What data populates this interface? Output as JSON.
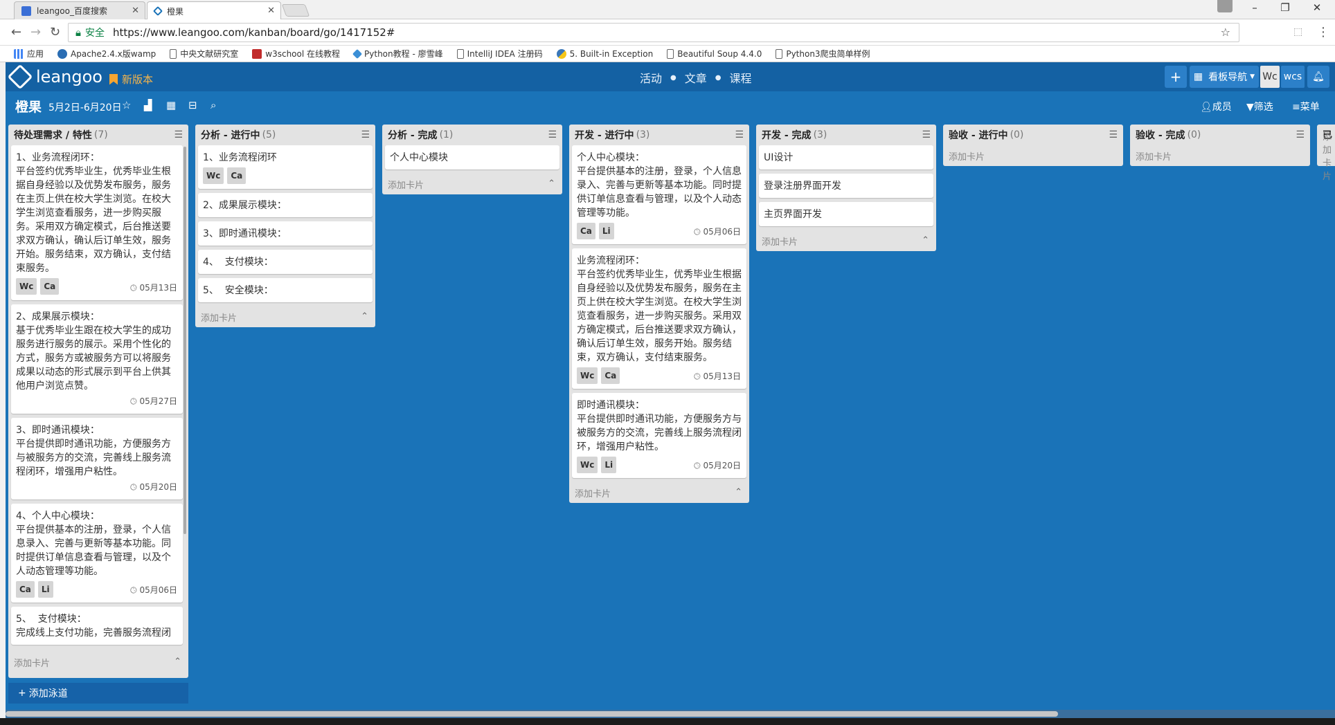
{
  "browser": {
    "tabs": [
      {
        "title": "leangoo_百度搜索",
        "active": false
      },
      {
        "title": "橙果",
        "active": true
      }
    ],
    "security_label": "安全",
    "url": "https://www.leangoo.com/kanban/board/go/1417152#",
    "bookmarks": [
      "应用",
      "Apache2.4.x版wamp",
      "中央文献研究室",
      "w3school 在线教程",
      "Python教程 - 廖雪峰",
      "IntelliJ IDEA 注册码",
      "5. Built-in Exception",
      "Beautiful Soup 4.4.0",
      "Python3爬虫简单样例"
    ]
  },
  "app": {
    "logo": "leangoo",
    "new_version": "新版本",
    "center_nav": [
      "活动",
      "文章",
      "课程"
    ],
    "board_nav_label": "看板导航",
    "avatars": [
      "Wc",
      "wcs"
    ],
    "board_title": "橙果",
    "board_dates": "5月2日-6月20日",
    "right_actions": [
      "成员",
      "筛选",
      "菜单"
    ],
    "add_card": "添加卡片",
    "add_lane": "添加泳道"
  },
  "lists": [
    {
      "name": "待处理需求 / 特性",
      "count": "(7)",
      "cards": [
        {
          "title": "1、业务流程闭环：\n平台签约优秀毕业生，优秀毕业生根据自身经验以及优势发布服务，服务在主页上供在校大学生浏览。在校大学生浏览查看服务，进一步购买服务。采用双方确定模式，后台推送要求双方确认，确认后订单生效，服务开始。服务结束，双方确认，支付结束服务。",
          "tags": [
            "Wc",
            "Ca"
          ],
          "date": "05月13日"
        },
        {
          "title": "2、成果展示模块：\n基于优秀毕业生跟在校大学生的成功服务进行服务的展示。采用个性化的方式，服务方或被服务方可以将服务成果以动态的形式展示到平台上供其他用户浏览点赞。",
          "tags": [],
          "date": "05月27日"
        },
        {
          "title": "3、即时通讯模块：\n平台提供即时通讯功能，方便服务方与被服务方的交流，完善线上服务流程闭环，增强用户粘性。",
          "tags": [],
          "date": "05月20日"
        },
        {
          "title": "4、个人中心模块：\n平台提供基本的注册，登录，个人信息录入、完善与更新等基本功能。同时提供订单信息查看与管理，以及个人动态管理等功能。",
          "tags": [
            "Ca",
            "Li"
          ],
          "date": "05月06日"
        },
        {
          "title": "5、  支付模块：\n完成线上支付功能，完善服务流程闭",
          "tags": [],
          "date": ""
        }
      ]
    },
    {
      "name": "分析  - 进行中",
      "count": "(5)",
      "cards": [
        {
          "title": "1、业务流程闭环",
          "tags": [
            "Wc",
            "Ca"
          ],
          "date": ""
        },
        {
          "title": "2、成果展示模块：",
          "tags": [],
          "date": ""
        },
        {
          "title": "3、即时通讯模块：",
          "tags": [],
          "date": ""
        },
        {
          "title": "4、  支付模块：",
          "tags": [],
          "date": ""
        },
        {
          "title": "5、  安全模块：",
          "tags": [],
          "date": ""
        }
      ]
    },
    {
      "name": "分析 - 完成",
      "count": "(1)",
      "cards": [
        {
          "title": "个人中心模块",
          "tags": [],
          "date": ""
        }
      ]
    },
    {
      "name": "开发 - 进行中",
      "count": "(3)",
      "cards": [
        {
          "title": "个人中心模块：\n平台提供基本的注册，登录，个人信息录入、完善与更新等基本功能。同时提供订单信息查看与管理，以及个人动态管理等功能。",
          "tags": [
            "Ca",
            "Li"
          ],
          "date": "05月06日"
        },
        {
          "title": "业务流程闭环：\n平台签约优秀毕业生，优秀毕业生根据自身经验以及优势发布服务，服务在主页上供在校大学生浏览。在校大学生浏览查看服务，进一步购买服务。采用双方确定模式，后台推送要求双方确认，确认后订单生效，服务开始。服务结束，双方确认，支付结束服务。",
          "tags": [
            "Wc",
            "Ca"
          ],
          "date": "05月13日"
        },
        {
          "title": "即时通讯模块：\n平台提供即时通讯功能，方便服务方与被服务方的交流，完善线上服务流程闭环，增强用户粘性。",
          "tags": [
            "Wc",
            "Li"
          ],
          "date": "05月20日"
        }
      ]
    },
    {
      "name": "开发 - 完成",
      "count": "(3)",
      "cards": [
        {
          "title": "UI设计",
          "tags": [],
          "date": ""
        },
        {
          "title": "登录注册界面开发",
          "tags": [],
          "date": ""
        },
        {
          "title": "主页界面开发",
          "tags": [],
          "date": ""
        }
      ]
    },
    {
      "name": "验收 - 进行中",
      "count": "(0)",
      "cards": []
    },
    {
      "name": "验收 - 完成",
      "count": "(0)",
      "cards": []
    },
    {
      "name": "已",
      "count": "",
      "cards": []
    }
  ]
}
